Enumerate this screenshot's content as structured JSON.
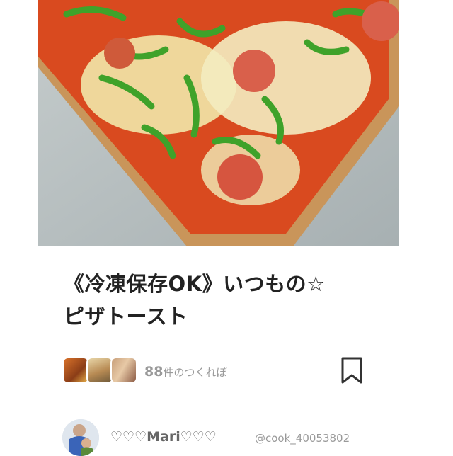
{
  "recipe": {
    "title_line1": "《冷凍保存OK》いつもの☆",
    "title_line2": "ピザトースト",
    "image_alt": "pizza-toast-photo"
  },
  "reports": {
    "count": "88",
    "label": "件のつくれぽ",
    "thumbnails": [
      "report-thumbnail-1",
      "report-thumbnail-2",
      "report-thumbnail-3"
    ]
  },
  "bookmark": {
    "icon": "bookmark-icon"
  },
  "author": {
    "name": "♡♡♡Mari♡♡♡",
    "handle": "@cook_40053802",
    "avatar": "author-avatar"
  },
  "colors": {
    "accent_text": "#222222",
    "muted_text": "#9a9a9a"
  }
}
